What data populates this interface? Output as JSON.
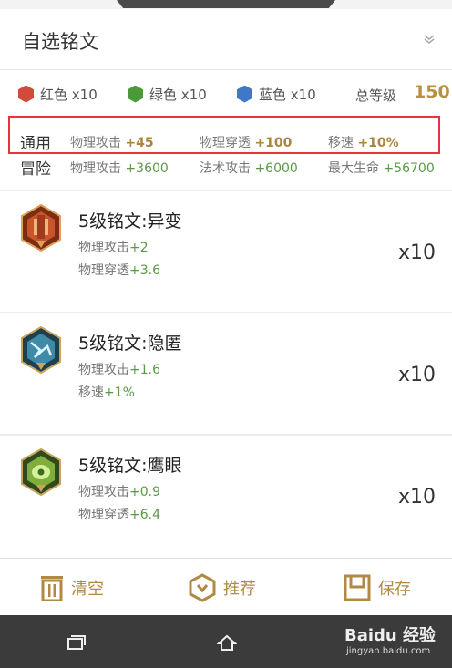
{
  "header": {
    "title": "自选铭文"
  },
  "summary": {
    "colors": [
      {
        "label": "红色 x10",
        "hex": "#d24a3a"
      },
      {
        "label": "绿色 x10",
        "hex": "#4b9a3a"
      },
      {
        "label": "蓝色 x10",
        "hex": "#3f78c9"
      }
    ],
    "total_label": "总等级",
    "total_value": "150"
  },
  "stats": {
    "general": {
      "label": "通用",
      "items": [
        {
          "name": "物理攻击",
          "value": "+45"
        },
        {
          "name": "物理穿透",
          "value": "+100"
        },
        {
          "name": "移速",
          "value": "+10%"
        }
      ]
    },
    "adventure": {
      "label": "冒险",
      "items": [
        {
          "name": "物理攻击",
          "value": "+3600"
        },
        {
          "name": "法术攻击",
          "value": "+6000"
        },
        {
          "name": "最大生命",
          "value": "+56700"
        }
      ]
    }
  },
  "runes": [
    {
      "title": "5级铭文:异变",
      "stats": [
        {
          "name": "物理攻击",
          "value": "+2"
        },
        {
          "name": "物理穿透",
          "value": "+3.6"
        }
      ],
      "count": "x10",
      "icon": "red-rune-icon"
    },
    {
      "title": "5级铭文:隐匿",
      "stats": [
        {
          "name": "物理攻击",
          "value": "+1.6"
        },
        {
          "name": "移速",
          "value": "+1%"
        }
      ],
      "count": "x10",
      "icon": "blue-rune-icon"
    },
    {
      "title": "5级铭文:鹰眼",
      "stats": [
        {
          "name": "物理攻击",
          "value": "+0.9"
        },
        {
          "name": "物理穿透",
          "value": "+6.4"
        }
      ],
      "count": "x10",
      "icon": "green-rune-icon"
    }
  ],
  "toolbar": {
    "clear_label": "清空",
    "recommend_label": "推荐",
    "save_label": "保存"
  },
  "watermark": {
    "main": "Baidu 经验",
    "sub": "jingyan.baidu.com"
  },
  "colors": {
    "accent": "#b08a44",
    "highlight_frame": "#e8323c",
    "stat_green": "#5a9a46"
  }
}
